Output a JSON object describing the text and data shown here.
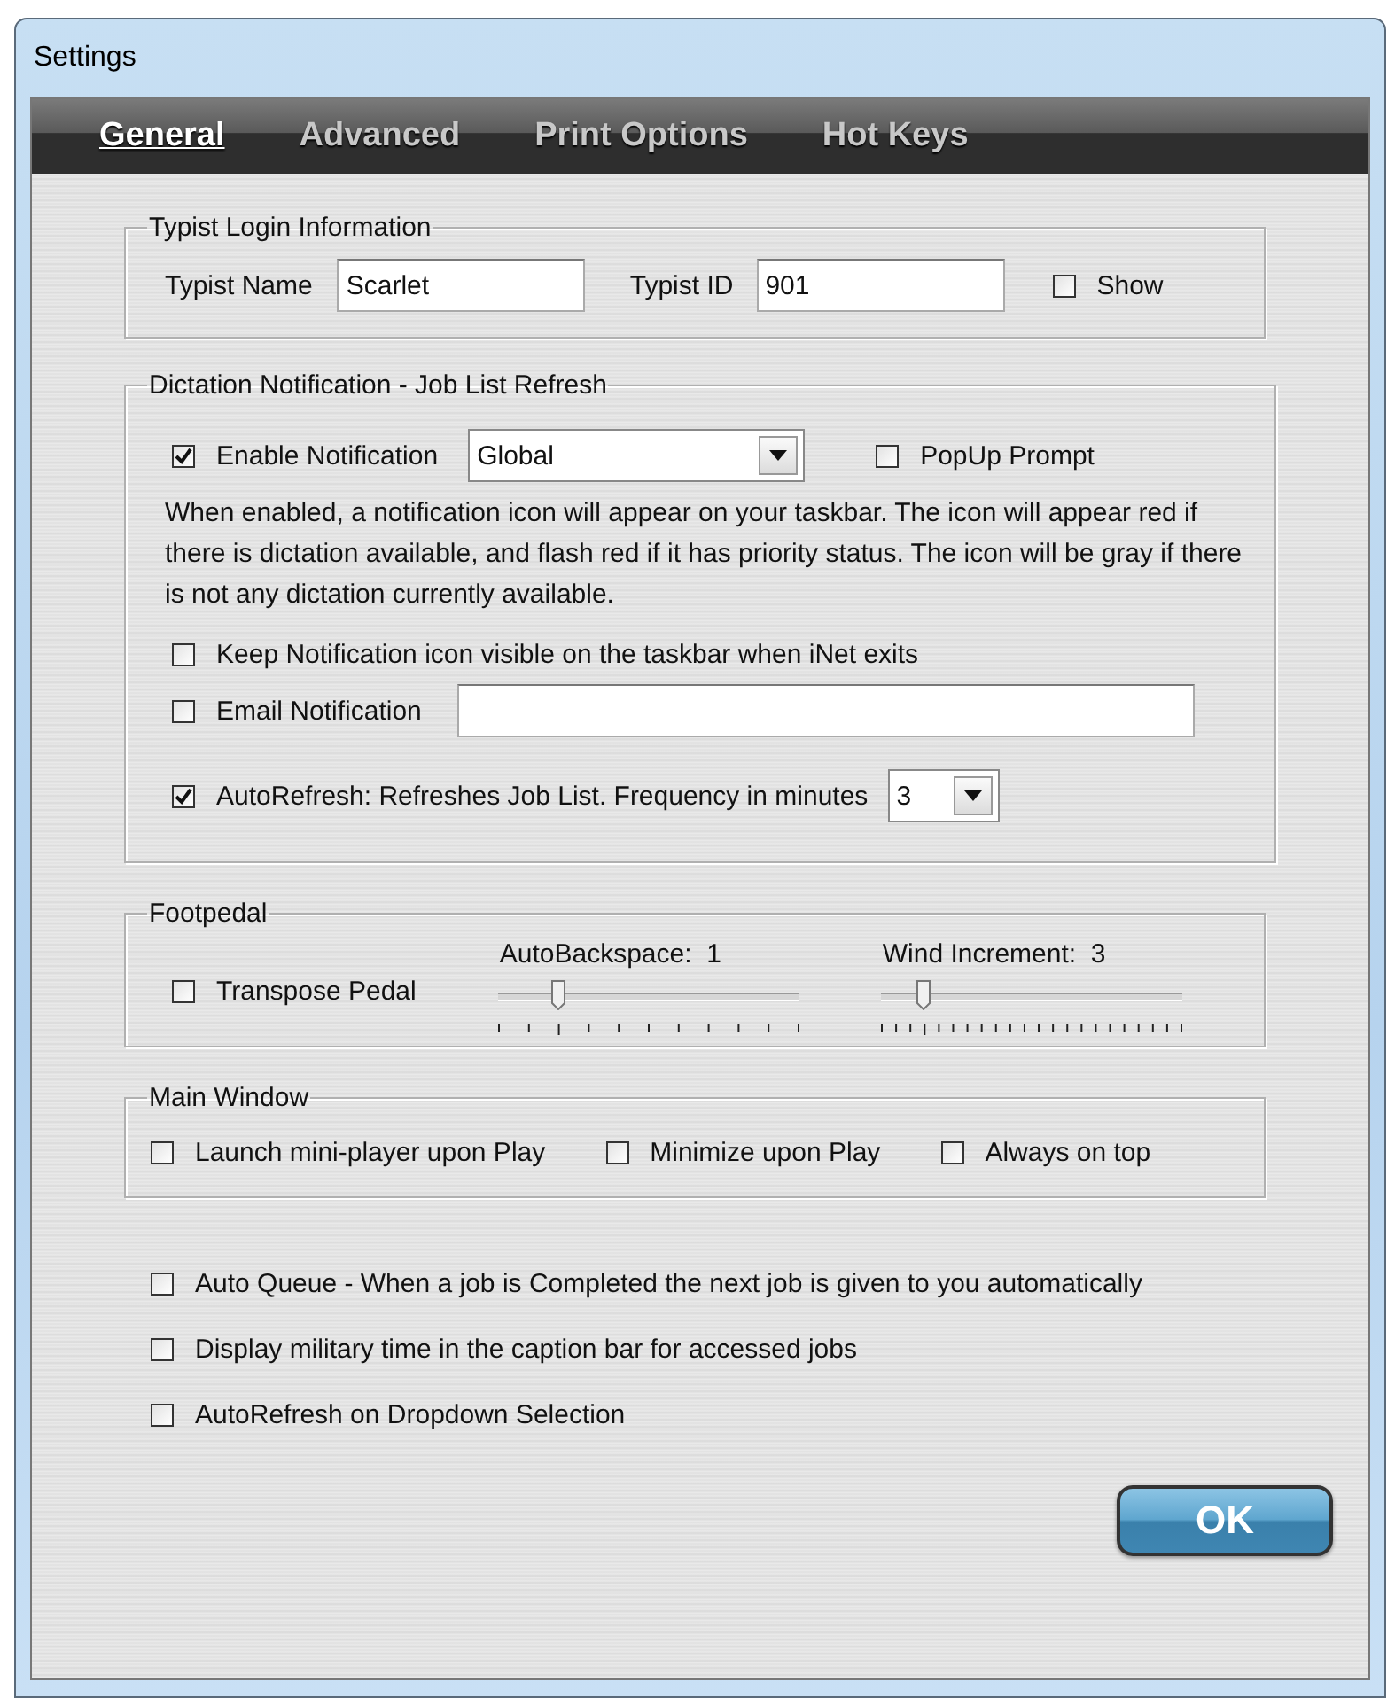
{
  "window": {
    "title": "Settings"
  },
  "tabs": [
    {
      "label": "General",
      "selected": true
    },
    {
      "label": "Advanced",
      "selected": false
    },
    {
      "label": "Print Options",
      "selected": false
    },
    {
      "label": "Hot Keys",
      "selected": false
    }
  ],
  "typist_login": {
    "title": "Typist Login Information",
    "name_label": "Typist Name",
    "name_value": "Scarlet",
    "id_label": "Typist ID",
    "id_value": "901",
    "show": {
      "label": "Show",
      "checked": false
    }
  },
  "dictation": {
    "title": "Dictation Notification - Job List Refresh",
    "enable_notification": {
      "label": "Enable Notification",
      "checked": true
    },
    "scope": {
      "value": "Global"
    },
    "popup_prompt": {
      "label": "PopUp Prompt",
      "checked": false
    },
    "description": "When enabled, a notification icon will appear on your taskbar. The icon will appear red if there is dictation available, and flash red if it has priority status. The icon will be gray if there is not any dictation currently available.",
    "keep_icon": {
      "label": "Keep Notification icon visible on the taskbar when iNet exits",
      "checked": false
    },
    "email_notification": {
      "label": "Email Notification",
      "checked": false
    },
    "autorefresh": {
      "label": "AutoRefresh: Refreshes Job List.  Frequency in minutes",
      "checked": true
    },
    "frequency": {
      "value": "3"
    }
  },
  "footpedal": {
    "title": "Footpedal",
    "transpose": {
      "label": "Transpose Pedal",
      "checked": false
    },
    "sliders": [
      {
        "label": "AutoBackspace:  1",
        "level": 0.2
      },
      {
        "label": "Wind Increment:  3",
        "level": 0.14
      }
    ]
  },
  "main_window": {
    "title": "Main Window",
    "options": [
      {
        "label": "Launch mini-player upon Play",
        "checked": false
      },
      {
        "label": "Minimize upon Play",
        "checked": false
      },
      {
        "label": "Always on top",
        "checked": false
      }
    ]
  },
  "options": [
    {
      "label": "Auto Queue - When a job is Completed the next job is given to you automatically",
      "checked": false
    },
    {
      "label": "Display military time in the caption bar for accessed jobs",
      "checked": false
    },
    {
      "label": "AutoRefresh on Dropdown Selection",
      "checked": false
    }
  ],
  "ok_button": "OK"
}
